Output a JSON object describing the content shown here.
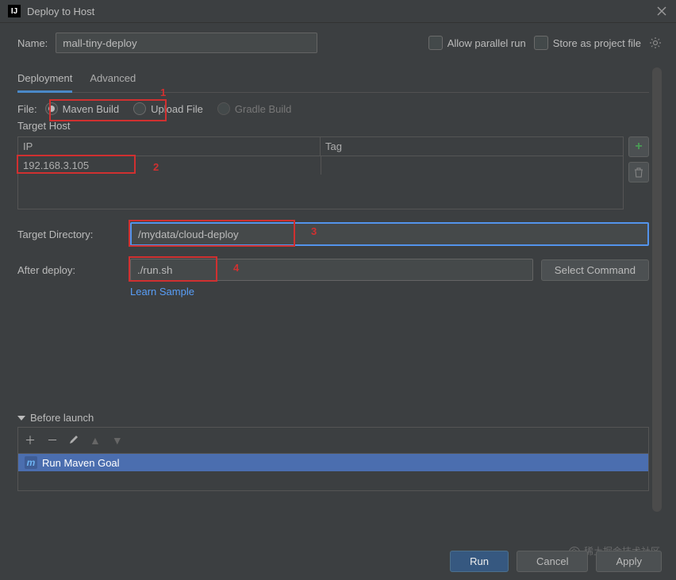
{
  "window": {
    "title": "Deploy to Host",
    "app_icon_text": "IJ"
  },
  "top": {
    "name_label": "Name:",
    "name_value": "mall-tiny-deploy",
    "allow_parallel_label": "Allow parallel run",
    "store_project_label": "Store as project file"
  },
  "tabs": {
    "deployment": "Deployment",
    "advanced": "Advanced"
  },
  "file_row": {
    "label": "File:",
    "options": {
      "maven": "Maven Build",
      "upload": "Upload File",
      "gradle": "Gradle Build"
    }
  },
  "annotations": {
    "n1": "1",
    "n2": "2",
    "n3": "3",
    "n4": "4"
  },
  "target_host": {
    "label": "Target Host",
    "headers": {
      "ip": "IP",
      "tag": "Tag"
    },
    "rows": [
      {
        "ip": "192.168.3.105",
        "tag": ""
      }
    ]
  },
  "target_directory": {
    "label": "Target Directory:",
    "value": "/mydata/cloud-deploy"
  },
  "after_deploy": {
    "label": "After deploy:",
    "value": "./run.sh",
    "select_btn": "Select Command",
    "learn_link": "Learn Sample"
  },
  "before_launch": {
    "title": "Before launch",
    "item": "Run Maven Goal"
  },
  "footer": {
    "run": "Run",
    "cancel": "Cancel",
    "apply": "Apply"
  },
  "watermark": "稀土掘金技术社区"
}
